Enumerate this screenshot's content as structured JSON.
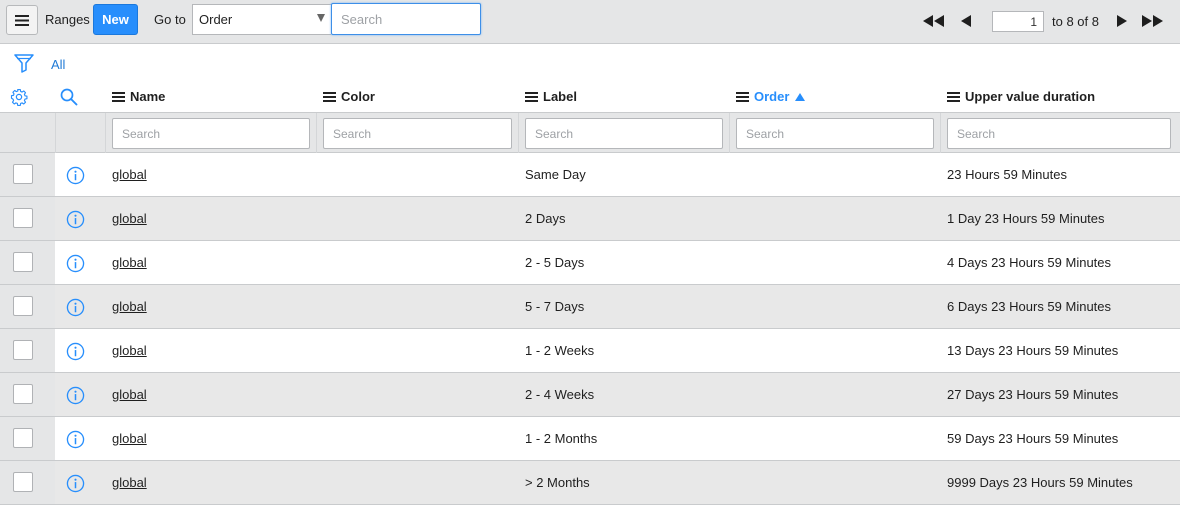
{
  "toolbar": {
    "title": "Ranges",
    "new_label": "New",
    "goto_label": "Go to",
    "goto_field": "Order",
    "goto_search_placeholder": "Search",
    "page_current": "1",
    "page_total": "to 8 of 8"
  },
  "filter": {
    "label": "All"
  },
  "columns": [
    {
      "label": "Name",
      "sorted": false
    },
    {
      "label": "Color",
      "sorted": false
    },
    {
      "label": "Label",
      "sorted": false
    },
    {
      "label": "Order",
      "sorted": true,
      "direction": "ascending"
    },
    {
      "label": "Upper value duration",
      "sorted": false
    }
  ],
  "column_search_placeholder": "Search",
  "rows": [
    {
      "name": "global",
      "color": "",
      "label": "Same Day",
      "order": "",
      "upper": "23 Hours 59 Minutes"
    },
    {
      "name": "global",
      "color": "",
      "label": "2 Days",
      "order": "",
      "upper": "1 Day 23 Hours 59 Minutes"
    },
    {
      "name": "global",
      "color": "",
      "label": "2 - 5 Days",
      "order": "",
      "upper": "4 Days 23 Hours 59 Minutes"
    },
    {
      "name": "global",
      "color": "",
      "label": "5 - 7 Days",
      "order": "",
      "upper": "6 Days 23 Hours 59 Minutes"
    },
    {
      "name": "global",
      "color": "",
      "label": "1 - 2 Weeks",
      "order": "",
      "upper": "13 Days 23 Hours 59 Minutes"
    },
    {
      "name": "global",
      "color": "",
      "label": "2 - 4 Weeks",
      "order": "",
      "upper": "27 Days 23 Hours 59 Minutes"
    },
    {
      "name": "global",
      "color": "",
      "label": "1 - 2 Months",
      "order": "",
      "upper": "59 Days 23 Hours 59 Minutes"
    },
    {
      "name": "global",
      "color": "",
      "label": "> 2 Months",
      "order": "",
      "upper": "9999 Days 23 Hours 59 Minutes"
    }
  ],
  "colors": {
    "accent": "#278efc",
    "toolbar_bg": "#e5e6e7",
    "row_alt_bg": "#e8e8e8"
  },
  "icons": {
    "menu": "hamburger-icon",
    "filter": "funnel-icon",
    "settings": "gear-icon",
    "column_search": "search-icon",
    "row_info": "info-icon",
    "pager": [
      "first-page-icon",
      "previous-page-icon",
      "next-page-icon",
      "last-page-icon"
    ]
  }
}
